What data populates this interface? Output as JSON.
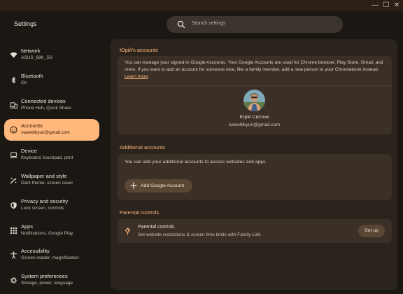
{
  "window": {
    "minimize_glyph": "—",
    "maximize_glyph": "☐",
    "close_glyph": "✕"
  },
  "app_title": "Settings",
  "search": {
    "placeholder": "Search settings",
    "icon": "search-icon"
  },
  "sidebar": {
    "items": [
      {
        "label": "Network",
        "sub": "ASUS_68K_5G",
        "icon": "wifi-icon",
        "active": false
      },
      {
        "label": "Bluetooth",
        "sub": "On",
        "icon": "bluetooth-icon",
        "active": false
      },
      {
        "label": "Connected devices",
        "sub": "Phone Hub, Quick Share",
        "icon": "devices-icon",
        "active": false
      },
      {
        "label": "Accounts",
        "sub": "sweetlikyuri@gmail.com",
        "icon": "account-icon",
        "active": true
      },
      {
        "label": "Device",
        "sub": "Keyboard, touchpad, print",
        "icon": "laptop-icon",
        "active": false
      },
      {
        "label": "Wallpaper and style",
        "sub": "Dark theme, screen saver",
        "icon": "palette-icon",
        "active": false
      },
      {
        "label": "Privacy and security",
        "sub": "Lock screen, controls",
        "icon": "shield-icon",
        "active": false
      },
      {
        "label": "Apps",
        "sub": "Notifications, Google Play",
        "icon": "apps-grid-icon",
        "active": false
      },
      {
        "label": "Accessibility",
        "sub": "Screen reader, magnification",
        "icon": "accessibility-icon",
        "active": false
      },
      {
        "label": "System preferences",
        "sub": "Storage, power, language",
        "icon": "gear-icon",
        "active": false
      }
    ]
  },
  "accounts_section": {
    "title": "Юрій's accounts",
    "description": "You can manage your signed-in Google Accounts. Your Google Accounts are used for Chrome browser, Play Store, Gmail, and more. If you want to add an account for someone else, like a family member, add a new person to your Chromebook instead.",
    "learn_more": "Learn more",
    "user_name": "Юрій Світлик",
    "user_email": "sweetlikyuri@gmail.com"
  },
  "additional_section": {
    "title": "Additional accounts",
    "description": "You can add your additional accounts to access websites and apps.",
    "add_button": "Add Google Account"
  },
  "parental_section": {
    "title": "Parental controls",
    "item_title": "Parental controls",
    "item_sub": "Set website restrictions & screen time limits with Family Link",
    "setup_button": "Set up"
  },
  "colors": {
    "accent": "#ffb77c",
    "background": "#1b1713",
    "panel": "#2b241d",
    "card": "#3a3027",
    "button": "#5a4633"
  }
}
